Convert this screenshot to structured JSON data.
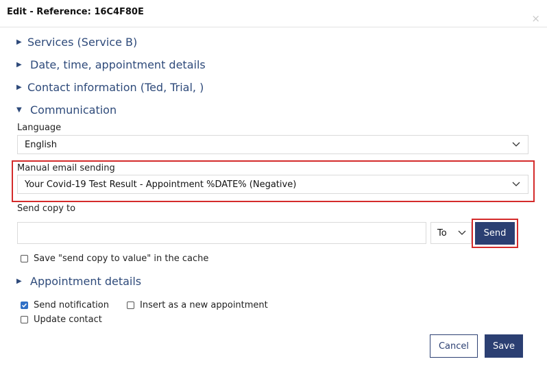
{
  "dialog": {
    "title": "Edit - Reference: 16C4F80E",
    "close_glyph": "×"
  },
  "sections": {
    "services": "Services (Service B)",
    "datetime": "Date, time, appointment details",
    "contact": "Contact information (Ted, Trial, )",
    "communication": "Communication",
    "appointment_details": "Appointment details"
  },
  "communication": {
    "language_label": "Language",
    "language_value": "English",
    "manual_email_label": "Manual email sending",
    "manual_email_value": "Your Covid-19 Test Result - Appointment %DATE% (Negative)",
    "send_copy_label": "Send copy to",
    "send_copy_value": "",
    "recipient_type": "To",
    "send_label": "Send",
    "cache_label": "Save \"send copy to value\" in the cache",
    "cache_checked": false
  },
  "options": {
    "send_notification": {
      "label": "Send notification",
      "checked": true
    },
    "insert_new": {
      "label": "Insert as a new appointment",
      "checked": false
    },
    "update_contact": {
      "label": "Update contact",
      "checked": false
    }
  },
  "footer": {
    "cancel_label": "Cancel",
    "save_label": "Save"
  },
  "colors": {
    "accent": "#2b3f72",
    "section_text": "#2e4a7a",
    "highlight": "#d42a2a",
    "checkbox_checked": "#2f6fc6"
  },
  "icons": {
    "collapsed": "triangle-right-icon",
    "expanded": "triangle-down-icon",
    "dropdown": "chevron-down-icon",
    "check": "checkmark-icon"
  }
}
